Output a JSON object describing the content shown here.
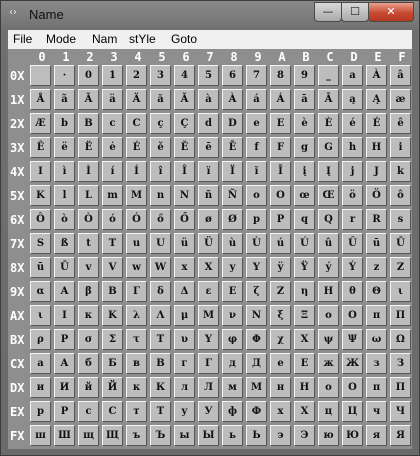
{
  "window": {
    "title": "Name",
    "icon": "code-brackets-icon"
  },
  "titlebar_buttons": {
    "minimize": "—",
    "maximize": "☐",
    "close": "✕"
  },
  "menu": [
    "File",
    "Mode",
    "Nam",
    "stYle",
    "Goto"
  ],
  "col_headers": [
    "0",
    "1",
    "2",
    "3",
    "4",
    "5",
    "6",
    "7",
    "8",
    "9",
    "A",
    "B",
    "C",
    "D",
    "E",
    "F"
  ],
  "row_headers": [
    "0X",
    "1X",
    "2X",
    "3X",
    "4X",
    "5X",
    "6X",
    "7X",
    "8X",
    "9X",
    "AX",
    "BX",
    "CX",
    "DX",
    "EX",
    "FX"
  ],
  "rows": [
    [
      "",
      "·",
      "0",
      "1",
      "2",
      "3",
      "4",
      "5",
      "6",
      "7",
      "8",
      "9",
      "_",
      "a",
      "À",
      "â"
    ],
    [
      "Å",
      "ã",
      "Ã",
      "ä",
      "Ä",
      "ă",
      "Ă",
      "à",
      "À",
      "á",
      "Á",
      "ā",
      "Ā",
      "ą",
      "Ą",
      "æ"
    ],
    [
      "Æ",
      "b",
      "B",
      "c",
      "C",
      "ç",
      "Ç",
      "d",
      "D",
      "e",
      "E",
      "è",
      "È",
      "é",
      "É",
      "ê"
    ],
    [
      "Ê",
      "ë",
      "Ë",
      "ė",
      "É",
      "ě",
      "Ě",
      "ē",
      "Ē",
      "f",
      "F",
      "g",
      "G",
      "h",
      "H",
      "i"
    ],
    [
      "I",
      "ì",
      "Ì",
      "í",
      "Í",
      "î",
      "Î",
      "ï",
      "Ï",
      "ĭ",
      "Ī",
      "į",
      "Į",
      "j",
      "J",
      "k"
    ],
    [
      "K",
      "l",
      "L",
      "m",
      "M",
      "n",
      "N",
      "ñ",
      "Ñ",
      "o",
      "O",
      "œ",
      "Œ",
      "ö",
      "Ö",
      "ô"
    ],
    [
      "Ô",
      "ò",
      "Ò",
      "ó",
      "Ó",
      "ő",
      "Ő",
      "ø",
      "Ø",
      "p",
      "P",
      "q",
      "Q",
      "r",
      "R",
      "s"
    ],
    [
      "S",
      "ß",
      "t",
      "T",
      "u",
      "U",
      "ü",
      "Ü",
      "ù",
      "Ù",
      "ú",
      "Ú",
      "û",
      "Û",
      "ū",
      "Ū"
    ],
    [
      "ū",
      "Ū",
      "v",
      "V",
      "w",
      "W",
      "x",
      "X",
      "y",
      "Y",
      "ÿ",
      "Ÿ",
      "ý",
      "Ý",
      "z",
      "Z"
    ],
    [
      "α",
      "A",
      "β",
      "B",
      "Γ",
      "δ",
      "Δ",
      "ε",
      "E",
      "ζ",
      "Z",
      "η",
      "H",
      "θ",
      "Θ",
      "ι"
    ],
    [
      "ι",
      "I",
      "κ",
      "K",
      "λ",
      "Λ",
      "μ",
      "M",
      "ν",
      "N",
      "ξ",
      "Ξ",
      "ο",
      "O",
      "π",
      "Π"
    ],
    [
      "ρ",
      "P",
      "σ",
      "Σ",
      "τ",
      "T",
      "υ",
      "Y",
      "φ",
      "Φ",
      "χ",
      "X",
      "ψ",
      "Ψ",
      "ω",
      "Ω"
    ],
    [
      "а",
      "А",
      "б",
      "Б",
      "в",
      "В",
      "г",
      "Г",
      "д",
      "Д",
      "е",
      "Е",
      "ж",
      "Ж",
      "з",
      "З"
    ],
    [
      "и",
      "И",
      "й",
      "Й",
      "к",
      "К",
      "л",
      "Л",
      "м",
      "М",
      "н",
      "Н",
      "о",
      "О",
      "п",
      "П"
    ],
    [
      "р",
      "Р",
      "с",
      "С",
      "т",
      "Т",
      "у",
      "У",
      "ф",
      "Ф",
      "х",
      "Х",
      "ц",
      "Ц",
      "ч",
      "Ч"
    ],
    [
      "ш",
      "Ш",
      "щ",
      "Щ",
      "ъ",
      "Ъ",
      "ы",
      "Ы",
      "ь",
      "Ь",
      "э",
      "Э",
      "ю",
      "Ю",
      "я",
      "Я"
    ]
  ]
}
